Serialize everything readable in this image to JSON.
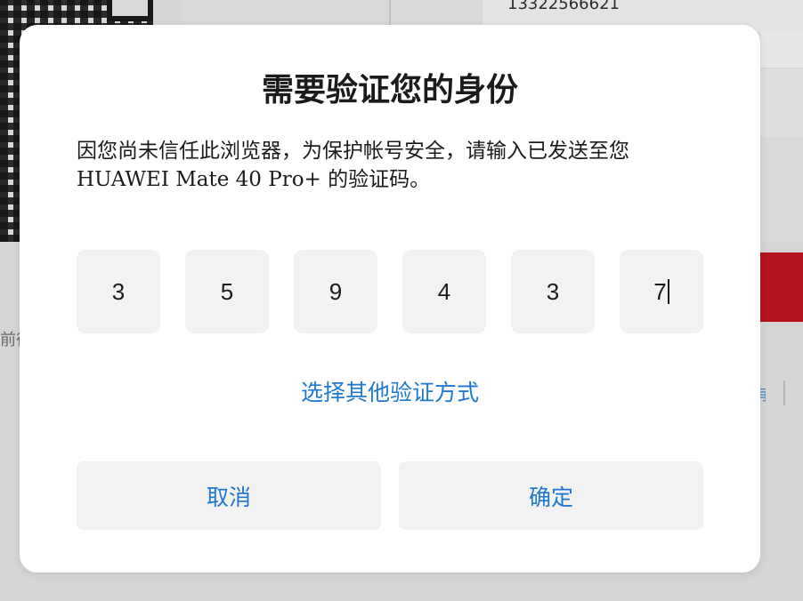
{
  "background": {
    "phone_number_partial": "13322566621",
    "left_text_partial": "前往",
    "right_link_partial": "有"
  },
  "dialog": {
    "title": "需要验证您的身份",
    "description": "因您尚未信任此浏览器，为保护帐号安全，请输入已发送至您 HUAWEI Mate 40 Pro+ 的验证码。",
    "code_digits": [
      "3",
      "5",
      "9",
      "4",
      "3",
      "7"
    ],
    "alt_method_link": "选择其他验证方式",
    "cancel_label": "取消",
    "confirm_label": "确定"
  },
  "colors": {
    "accent": "#1f78d1",
    "brand_red": "#b4141c",
    "box_background": "#f2f2f2"
  }
}
